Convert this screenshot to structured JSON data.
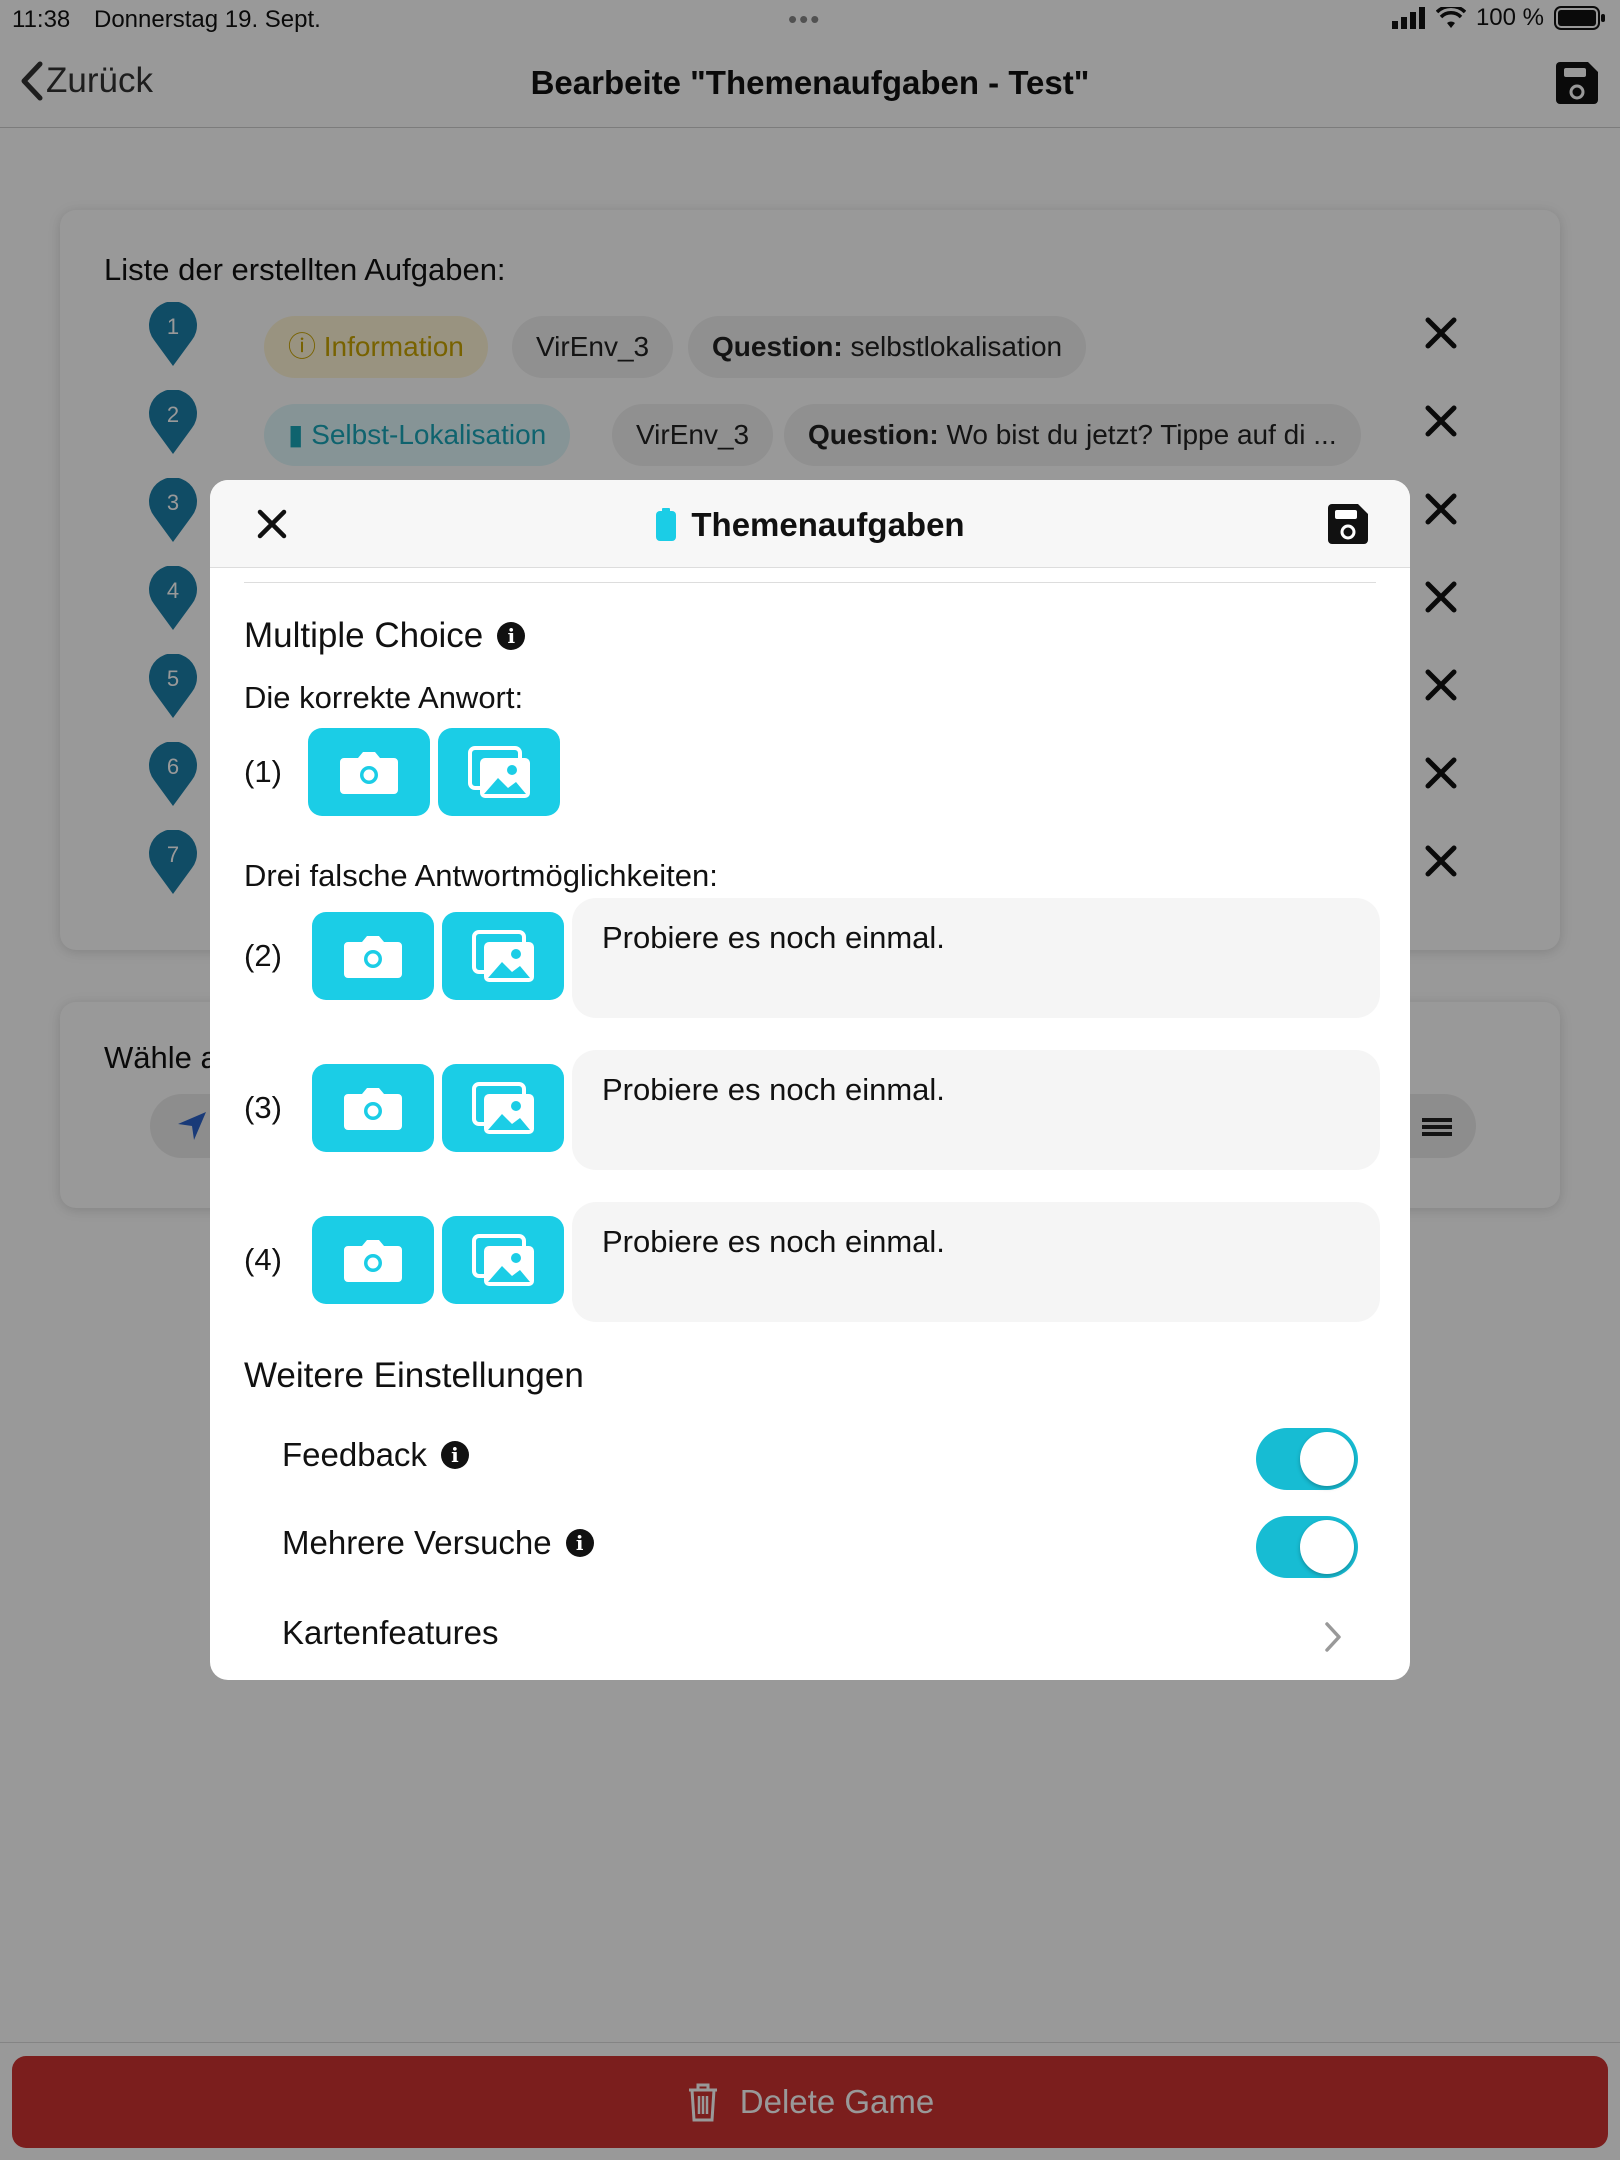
{
  "status_bar": {
    "time": "11:38",
    "date": "Donnerstag 19. Sept.",
    "dots": "•••",
    "battery": "100 %"
  },
  "nav": {
    "back_label": "Zurück",
    "title": "Bearbeite \"Themenaufgaben - Test\""
  },
  "task_list": {
    "heading": "Liste der erstellten Aufgaben:",
    "rows": [
      {
        "number": "1",
        "type": "Information",
        "env": "VirEnv_3",
        "question_label": "Question:",
        "question": "selbstlokalisation"
      },
      {
        "number": "2",
        "type": "Selbst-Lokalisation",
        "env": "VirEnv_3",
        "question_label": "Question:",
        "question": "Wo bist du jetzt? Tippe auf di ..."
      },
      {
        "number": "3"
      },
      {
        "number": "4"
      },
      {
        "number": "5"
      },
      {
        "number": "6"
      },
      {
        "number": "7"
      }
    ]
  },
  "second_card": {
    "label": "Wähle a"
  },
  "delete_button": {
    "label": "Delete Game"
  },
  "modal": {
    "title": "Themenaufgaben",
    "section_title": "Multiple Choice",
    "correct_label": "Die korrekte Anwort:",
    "wrong_label": "Drei falsche Antwortmöglichkeiten:",
    "answers": [
      {
        "number": "(1)"
      },
      {
        "number": "(2)",
        "text": "Probiere es noch einmal."
      },
      {
        "number": "(3)",
        "text": "Probiere es noch einmal."
      },
      {
        "number": "(4)",
        "text": "Probiere es noch einmal."
      }
    ],
    "settings_title": "Weitere Einstellungen",
    "settings": [
      {
        "label": "Feedback",
        "enabled": true
      },
      {
        "label": "Mehrere Versuche",
        "enabled": true
      },
      {
        "label": "Kartenfeatures"
      }
    ]
  },
  "colors": {
    "accent": "#1bcde6",
    "pin": "#1b7fa8",
    "danger": "#ce3231",
    "toggle": "#17bcd3"
  }
}
